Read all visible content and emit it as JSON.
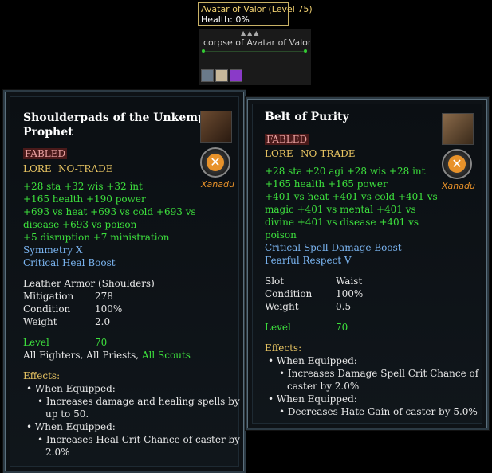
{
  "target": {
    "name": "Avatar of Valor (Level 75)",
    "health": "Health: 0%",
    "corpse": "corpse of Avatar of Valor"
  },
  "item1": {
    "title_line1": "Shoulderpads of the Unkempt",
    "title_line2": "Prophet",
    "tier": "FABLED",
    "flag1": "LORE",
    "flag2": "NO-TRADE",
    "adornment": "Xanadu",
    "stats": [
      "+28 sta  +32 wis  +32 int",
      "+165 health  +190 power",
      "+693 vs heat  +693 vs cold  +693 vs",
      "disease  +693 vs poison",
      "+5 disruption  +7 ministration"
    ],
    "mods": [
      "Symmetry X",
      "Critical Heal Boost"
    ],
    "armor_type": "Leather Armor (Shoulders)",
    "props": [
      {
        "label": "Mitigation",
        "value": "278"
      },
      {
        "label": "Condition",
        "value": "100%"
      },
      {
        "label": "Weight",
        "value": "2.0"
      }
    ],
    "level_label": "Level",
    "level_value": "70",
    "classes_white": "All Fighters, All Priests,",
    "classes_green": "All Scouts",
    "effects_label": "Effects:",
    "effects": [
      {
        "when": "When Equipped:",
        "desc1": "Increases damage and healing spells by",
        "desc2": "up to 50."
      },
      {
        "when": "When Equipped:",
        "desc1": "Increases Heal Crit Chance of caster by",
        "desc2": "2.0%"
      }
    ]
  },
  "item2": {
    "title": "Belt of Purity",
    "tier": "FABLED",
    "flag1": "LORE",
    "flag2": "NO-TRADE",
    "adornment": "Xanadu",
    "stats": [
      "+28 sta  +20 agi  +28 wis  +28 int",
      "+165 health  +165 power",
      "+401 vs heat  +401 vs cold  +401 vs",
      "magic  +401 vs mental  +401 vs",
      "divine  +401 vs disease  +401 vs",
      "poison"
    ],
    "mods": [
      "Critical Spell Damage Boost",
      "Fearful Respect V"
    ],
    "props": [
      {
        "label": "Slot",
        "value": "Waist"
      },
      {
        "label": "Condition",
        "value": "100%"
      },
      {
        "label": "Weight",
        "value": "0.5"
      }
    ],
    "level_label": "Level",
    "level_value": "70",
    "effects_label": "Effects:",
    "effects": [
      {
        "when": "When Equipped:",
        "desc1": "Increases Damage Spell Crit Chance of",
        "desc2": "caster by 2.0%"
      },
      {
        "when": "When Equipped:",
        "desc1": "Decreases Hate Gain of caster by 5.0%",
        "desc2": ""
      }
    ]
  },
  "colors": {
    "tier": "#e8a0a0",
    "gold": "#e8c462",
    "green": "#3de03d",
    "blue": "#7ab4f0"
  }
}
